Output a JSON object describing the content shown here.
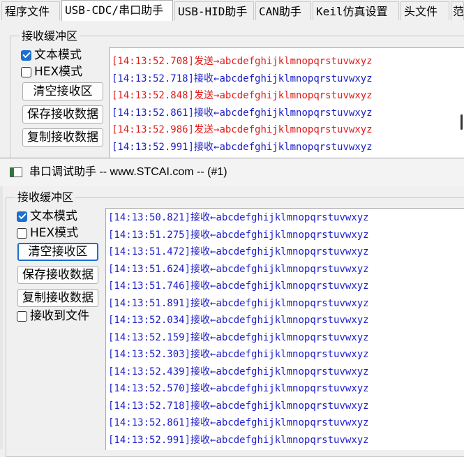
{
  "tabs": [
    {
      "label": "程序文件",
      "active": false
    },
    {
      "label": "USB-CDC/串口助手",
      "active": true
    },
    {
      "label": "USB-HID助手",
      "active": false
    },
    {
      "label": "CAN助手",
      "active": false
    },
    {
      "label": "Keil仿真设置",
      "active": false
    },
    {
      "label": "头文件",
      "active": false
    },
    {
      "label": "范",
      "active": false
    }
  ],
  "back_window": {
    "group_title": "接收缓冲区",
    "text_mode_label": "文本模式",
    "text_mode_checked": true,
    "hex_mode_label": "HEX模式",
    "hex_mode_checked": false,
    "clear_button": "清空接收区",
    "save_button": "保存接收数据",
    "copy_button": "复制接收数据",
    "lines": [
      {
        "ts": "[14:13:52.708]",
        "dir": "发送→",
        "type": "send",
        "text": "abcdefghijklmnopqrstuvwxyz"
      },
      {
        "ts": "[14:13:52.718]",
        "dir": "接收←",
        "type": "recv",
        "text": "abcdefghijklmnopqrstuvwxyz"
      },
      {
        "ts": "[14:13:52.848]",
        "dir": "发送→",
        "type": "send",
        "text": "abcdefghijklmnopqrstuvwxyz"
      },
      {
        "ts": "[14:13:52.861]",
        "dir": "接收←",
        "type": "recv",
        "text": "abcdefghijklmnopqrstuvwxyz"
      },
      {
        "ts": "[14:13:52.986]",
        "dir": "发送→",
        "type": "send",
        "text": "abcdefghijklmnopqrstuvwxyz"
      },
      {
        "ts": "[14:13:52.991]",
        "dir": "接收←",
        "type": "recv",
        "text": "abcdefghijklmnopqrstuvwxyz"
      }
    ]
  },
  "front_window": {
    "title": "串口调试助手 -- www.STCAI.com -- (#1)",
    "group_title": "接收缓冲区",
    "text_mode_label": "文本模式",
    "text_mode_checked": true,
    "hex_mode_label": "HEX模式",
    "hex_mode_checked": false,
    "clear_button": "清空接收区",
    "save_button": "保存接收数据",
    "copy_button": "复制接收数据",
    "receive_to_file_label": "接收到文件",
    "receive_to_file_checked": false,
    "lines": [
      {
        "ts": "[14:13:50.821]",
        "dir": "接收←",
        "text": "abcdefghijklmnopqrstuvwxyz"
      },
      {
        "ts": "[14:13:51.275]",
        "dir": "接收←",
        "text": "abcdefghijklmnopqrstuvwxyz"
      },
      {
        "ts": "[14:13:51.472]",
        "dir": "接收←",
        "text": "abcdefghijklmnopqrstuvwxyz"
      },
      {
        "ts": "[14:13:51.624]",
        "dir": "接收←",
        "text": "abcdefghijklmnopqrstuvwxyz"
      },
      {
        "ts": "[14:13:51.746]",
        "dir": "接收←",
        "text": "abcdefghijklmnopqrstuvwxyz"
      },
      {
        "ts": "[14:13:51.891]",
        "dir": "接收←",
        "text": "abcdefghijklmnopqrstuvwxyz"
      },
      {
        "ts": "[14:13:52.034]",
        "dir": "接收←",
        "text": "abcdefghijklmnopqrstuvwxyz"
      },
      {
        "ts": "[14:13:52.159]",
        "dir": "接收←",
        "text": "abcdefghijklmnopqrstuvwxyz"
      },
      {
        "ts": "[14:13:52.303]",
        "dir": "接收←",
        "text": "abcdefghijklmnopqrstuvwxyz"
      },
      {
        "ts": "[14:13:52.439]",
        "dir": "接收←",
        "text": "abcdefghijklmnopqrstuvwxyz"
      },
      {
        "ts": "[14:13:52.570]",
        "dir": "接收←",
        "text": "abcdefghijklmnopqrstuvwxyz"
      },
      {
        "ts": "[14:13:52.718]",
        "dir": "接收←",
        "text": "abcdefghijklmnopqrstuvwxyz"
      },
      {
        "ts": "[14:13:52.861]",
        "dir": "接收←",
        "text": "abcdefghijklmnopqrstuvwxyz"
      },
      {
        "ts": "[14:13:52.991]",
        "dir": "接收←",
        "text": "abcdefghijklmnopqrstuvwxyz"
      }
    ]
  },
  "colors": {
    "send": "#e01c1c",
    "recv": "#1d1dc8",
    "accent": "#1a6fd0"
  }
}
